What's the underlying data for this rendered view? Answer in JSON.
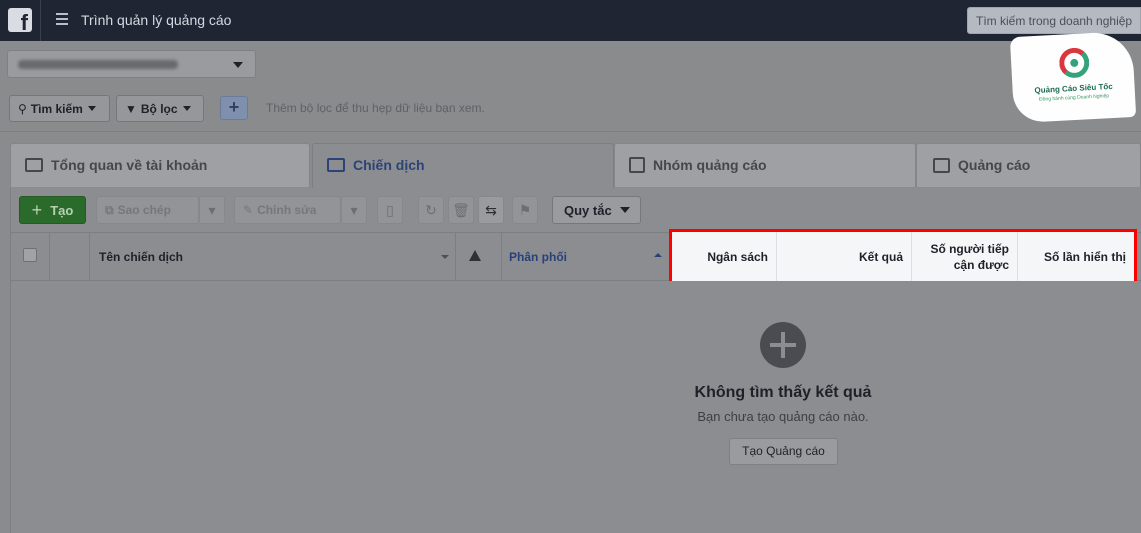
{
  "topbar": {
    "app_title": "Trình quản lý quảng cáo",
    "search_placeholder": "Tìm kiếm trong doanh nghiệp"
  },
  "filter_bar": {
    "search_label": "Tìm kiếm",
    "filter_label": "Bộ lọc",
    "add_label": "+",
    "hint": "Thêm bộ lọc để thu hẹp dữ liệu bạn xem."
  },
  "tabs": [
    {
      "label": "Tổng quan về tài khoản",
      "active": false
    },
    {
      "label": "Chiến dịch",
      "active": true
    },
    {
      "label": "Nhóm quảng cáo",
      "active": false
    },
    {
      "label": "Quảng cáo",
      "active": false
    }
  ],
  "toolbar": {
    "create_label": "Tạo",
    "duplicate_label": "Sao chép",
    "edit_label": "Chỉnh sửa",
    "rules_label": "Quy tắc"
  },
  "table": {
    "columns": {
      "campaign_name": "Tên chiến dịch",
      "delivery": "Phân phối",
      "budget": "Ngân sách",
      "results": "Kết quả",
      "reach": "Số người tiếp cận được",
      "impressions": "Số lần hiển thị"
    }
  },
  "empty_state": {
    "title": "Không tìm thấy kết quả",
    "subtitle": "Bạn chưa tạo quảng cáo nào.",
    "button": "Tạo Quảng cáo"
  },
  "watermark": {
    "title": "Quảng Cáo Siêu Tốc",
    "subtitle": "Đồng hành cùng Doanh Nghiệp"
  },
  "colors": {
    "highlight_border": "#ff0000",
    "create_button": "#2a6b2c",
    "active_tab": "#2c4377"
  }
}
